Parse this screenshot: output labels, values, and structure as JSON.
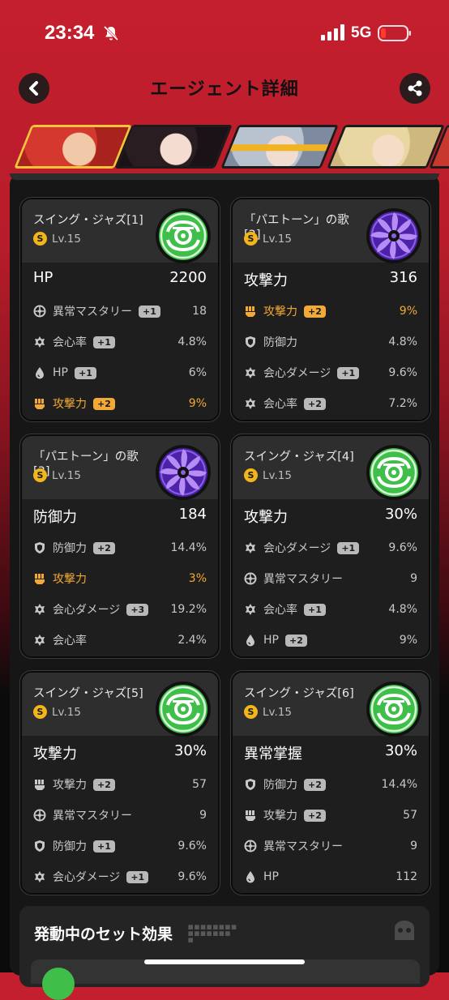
{
  "status_bar": {
    "time": "23:34",
    "network": "5G"
  },
  "header": {
    "title": "エージェント詳細"
  },
  "discs": [
    {
      "name": "スイング・ジャズ[1]",
      "level": "Lv.15",
      "disc_type": "green",
      "main_stat": {
        "label": "HP",
        "value": "2200"
      },
      "subs": [
        {
          "icon": "anomaly-icon",
          "label": "異常マスタリー",
          "badge": "+1",
          "value": "18",
          "hl": false
        },
        {
          "icon": "crit-icon",
          "label": "会心率",
          "badge": "+1",
          "value": "4.8%",
          "hl": false
        },
        {
          "icon": "hp-icon",
          "label": "HP",
          "badge": "+1",
          "value": "6%",
          "hl": false
        },
        {
          "icon": "atk-icon",
          "label": "攻撃力",
          "badge": "+2",
          "value": "9%",
          "hl": true
        }
      ]
    },
    {
      "name": "「パエトーン」の歌[2]",
      "level": "Lv.15",
      "disc_type": "purple",
      "main_stat": {
        "label": "攻撃力",
        "value": "316"
      },
      "subs": [
        {
          "icon": "atk-icon",
          "label": "攻撃力",
          "badge": "+2",
          "value": "9%",
          "hl": true
        },
        {
          "icon": "def-icon",
          "label": "防御力",
          "badge": "",
          "value": "4.8%",
          "hl": false
        },
        {
          "icon": "crit-icon",
          "label": "会心ダメージ",
          "badge": "+1",
          "value": "9.6%",
          "hl": false
        },
        {
          "icon": "crit-icon",
          "label": "会心率",
          "badge": "+2",
          "value": "7.2%",
          "hl": false
        }
      ]
    },
    {
      "name": "「パエトーン」の歌[3]",
      "level": "Lv.15",
      "disc_type": "purple",
      "main_stat": {
        "label": "防御力",
        "value": "184"
      },
      "subs": [
        {
          "icon": "def-icon",
          "label": "防御力",
          "badge": "+2",
          "value": "14.4%",
          "hl": false
        },
        {
          "icon": "atk-icon",
          "label": "攻撃力",
          "badge": "",
          "value": "3%",
          "hl": true
        },
        {
          "icon": "crit-icon",
          "label": "会心ダメージ",
          "badge": "+3",
          "value": "19.2%",
          "hl": false
        },
        {
          "icon": "crit-icon",
          "label": "会心率",
          "badge": "",
          "value": "2.4%",
          "hl": false
        }
      ]
    },
    {
      "name": "スイング・ジャズ[4]",
      "level": "Lv.15",
      "disc_type": "green",
      "main_stat": {
        "label": "攻撃力",
        "value": "30%"
      },
      "subs": [
        {
          "icon": "crit-icon",
          "label": "会心ダメージ",
          "badge": "+1",
          "value": "9.6%",
          "hl": false
        },
        {
          "icon": "anomaly-icon",
          "label": "異常マスタリー",
          "badge": "",
          "value": "9",
          "hl": false
        },
        {
          "icon": "crit-icon",
          "label": "会心率",
          "badge": "+1",
          "value": "4.8%",
          "hl": false
        },
        {
          "icon": "hp-icon",
          "label": "HP",
          "badge": "+2",
          "value": "9%",
          "hl": false
        }
      ]
    },
    {
      "name": "スイング・ジャズ[5]",
      "level": "Lv.15",
      "disc_type": "green",
      "main_stat": {
        "label": "攻撃力",
        "value": "30%"
      },
      "subs": [
        {
          "icon": "atk-icon",
          "label": "攻撃力",
          "badge": "+2",
          "value": "57",
          "hl": false
        },
        {
          "icon": "anomaly-icon",
          "label": "異常マスタリー",
          "badge": "",
          "value": "9",
          "hl": false
        },
        {
          "icon": "def-icon",
          "label": "防御力",
          "badge": "+1",
          "value": "9.6%",
          "hl": false
        },
        {
          "icon": "crit-icon",
          "label": "会心ダメージ",
          "badge": "+1",
          "value": "9.6%",
          "hl": false
        }
      ]
    },
    {
      "name": "スイング・ジャズ[6]",
      "level": "Lv.15",
      "disc_type": "green",
      "main_stat": {
        "label": "異常掌握",
        "value": "30%"
      },
      "subs": [
        {
          "icon": "def-icon",
          "label": "防御力",
          "badge": "+2",
          "value": "14.4%",
          "hl": false
        },
        {
          "icon": "atk-icon",
          "label": "攻撃力",
          "badge": "+2",
          "value": "57",
          "hl": false
        },
        {
          "icon": "anomaly-icon",
          "label": "異常マスタリー",
          "badge": "",
          "value": "9",
          "hl": false
        },
        {
          "icon": "hp-icon",
          "label": "HP",
          "badge": "",
          "value": "112",
          "hl": false
        }
      ]
    }
  ],
  "set_effects": {
    "title": "発動中のセット効果"
  },
  "colors": {
    "highlight": "#f2a935",
    "accent_red": "#c41f2e",
    "green_disc": "#3fbf4a",
    "purple_disc": "#6a3fd0"
  }
}
